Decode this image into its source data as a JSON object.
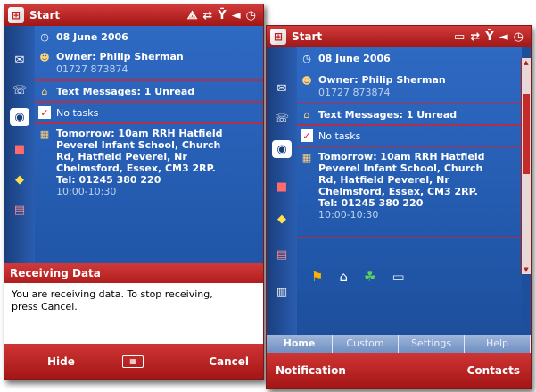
{
  "left": {
    "title": "Start",
    "date": "08 June 2006",
    "owner": "Owner: Philip Sherman",
    "phone": "01727 873874",
    "messages": "Text Messages: 1 Unread",
    "tasks": "No tasks",
    "appointment": {
      "line1": "Tomorrow: 10am RRH Hatfield",
      "line2": "Peverel Infant School, Church",
      "line3": "Rd, Hatfield Peverel, Nr",
      "line4": "Chelmsford, Essex, CM3 2RP.",
      "line5": "Tel: 01245 380 220",
      "time": "10:00-10:30"
    },
    "popup": {
      "title": "Receiving Data",
      "line1": "You are receiving data. To stop receiving,",
      "line2": "press Cancel."
    },
    "softkeys": {
      "left": "Hide",
      "right": "Cancel"
    }
  },
  "right": {
    "title": "Start",
    "date": "08 June 2006",
    "owner": "Owner: Philip Sherman",
    "phone": "01727 873874",
    "messages": "Text Messages: 1 Unread",
    "tasks": "No tasks",
    "appointment": {
      "line1": "Tomorrow: 10am RRH Hatfield",
      "line2": "Peverel Infant School, Church",
      "line3": "Rd, Hatfield Peverel, Nr",
      "line4": "Chelmsford, Essex, CM3 2RP.",
      "line5": "Tel: 01245 380 220",
      "time": "10:00-10:30"
    },
    "tabs": [
      "Home",
      "Custom",
      "Settings",
      "Help"
    ],
    "softkeys": {
      "left": "Notification",
      "right": "Contacts"
    }
  }
}
